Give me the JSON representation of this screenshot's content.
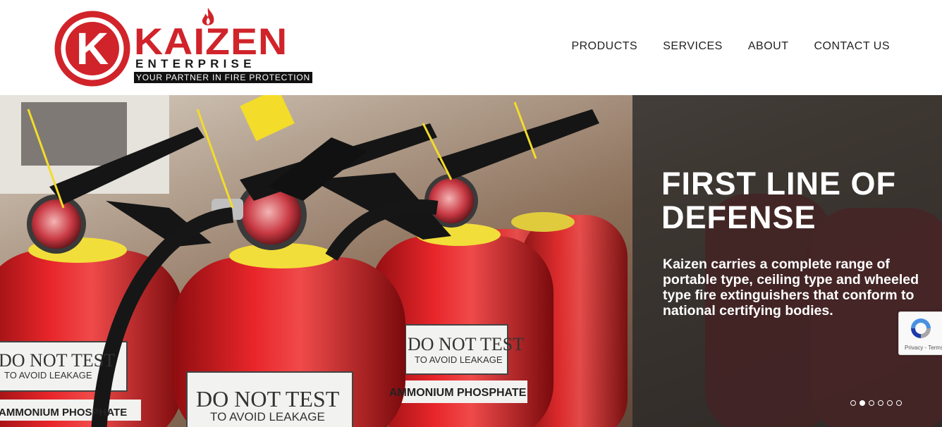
{
  "brand": {
    "logo_letter": "K",
    "name": "KAIZEN",
    "sub": "ENTERPRISE",
    "tagline": "YOUR PARTNER IN FIRE PROTECTION",
    "color": "#d1232a"
  },
  "nav": {
    "items": [
      {
        "label": "PRODUCTS"
      },
      {
        "label": "SERVICES"
      },
      {
        "label": "ABOUT"
      },
      {
        "label": "CONTACT US"
      }
    ]
  },
  "hero": {
    "headline": "FIRST LINE OF DEFENSE",
    "body": "Kaizen carries a complete range of portable type, ceiling type and wheeled type fire extinguishers that conform to national certifying bodies.",
    "photo_labels": {
      "do_not_test": "DO NOT TEST",
      "avoid_leakage": "TO AVOID LEAKAGE",
      "phosphate": "AMMONIUM PHOSPHATE"
    },
    "slides": {
      "count": 6,
      "active_index": 1
    }
  },
  "recaptcha": {
    "label": "Privacy - Terms"
  }
}
